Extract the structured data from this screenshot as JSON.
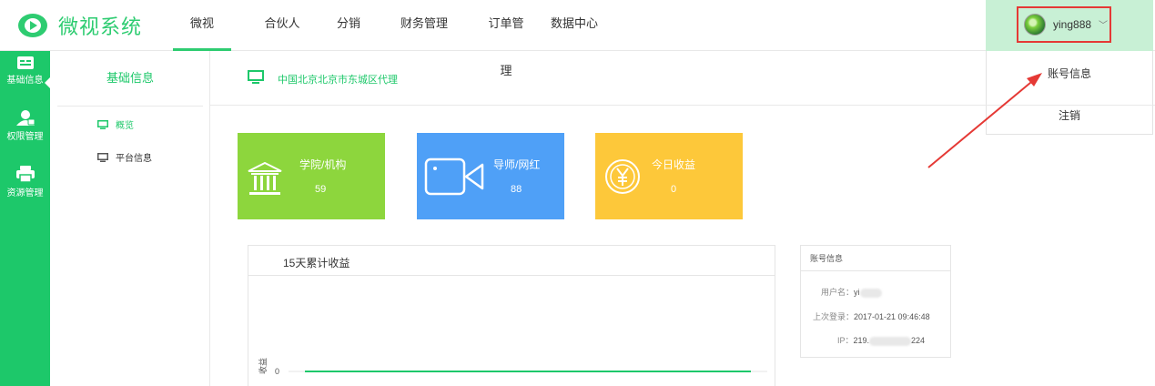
{
  "brand": {
    "name": "微视系统",
    "color": "#2ecc71"
  },
  "nav": {
    "items": [
      {
        "label": "微视",
        "active": true
      },
      {
        "label": "合伙人",
        "active": false
      },
      {
        "label": "分销",
        "active": false
      },
      {
        "label": "财务管理",
        "active": false
      },
      {
        "label": "订单管理",
        "active": false
      },
      {
        "label": "数据中心",
        "active": false
      }
    ]
  },
  "user": {
    "name": "ying888",
    "chevron": "chevron-down-icon"
  },
  "dropdown": {
    "items": [
      {
        "label": "账号信息"
      },
      {
        "label": "注销"
      }
    ]
  },
  "sidebar": {
    "items": [
      {
        "label": "基础信息",
        "icon": "card-icon",
        "active": true
      },
      {
        "label": "权限管理",
        "icon": "user-icon",
        "active": false
      },
      {
        "label": "资源管理",
        "icon": "printer-icon",
        "active": false
      }
    ]
  },
  "subnav": {
    "title": "基础信息",
    "items": [
      {
        "label": "概览",
        "icon": "monitor-icon",
        "active": true
      },
      {
        "label": "平台信息",
        "icon": "monitor-icon",
        "active": false
      }
    ]
  },
  "breadcrumb": {
    "text": "中国北京北京市东城区代理",
    "icon": "monitor-icon"
  },
  "cards": [
    {
      "title": "学院/机构",
      "value": "59",
      "icon": "institution-icon",
      "color": "#8dd63d"
    },
    {
      "title": "导师/网红",
      "value": "88",
      "icon": "video-camera-icon",
      "color": "#4fa0f7"
    },
    {
      "title": "今日收益",
      "value": "0",
      "icon": "yen-icon",
      "color": "#fdc83a"
    }
  ],
  "chart": {
    "title": "15天累计收益",
    "chart_data": {
      "type": "line",
      "title": "15天累计收益",
      "ylabel": "收益",
      "y_ticks": [
        "0"
      ],
      "series": [
        {
          "values": [
            0,
            0,
            0,
            0,
            0,
            0,
            0,
            0,
            0,
            0,
            0,
            0,
            0,
            0,
            0
          ]
        }
      ],
      "color": "#1dc86a"
    }
  },
  "account": {
    "title": "账号信息",
    "username_label": "用户名：",
    "username_value": "yi",
    "last_login_label": "上次登录：",
    "last_login_value": "2017-01-21 09:46:48",
    "ip_label": "IP：",
    "ip_prefix": "219.",
    "ip_suffix": "224"
  }
}
